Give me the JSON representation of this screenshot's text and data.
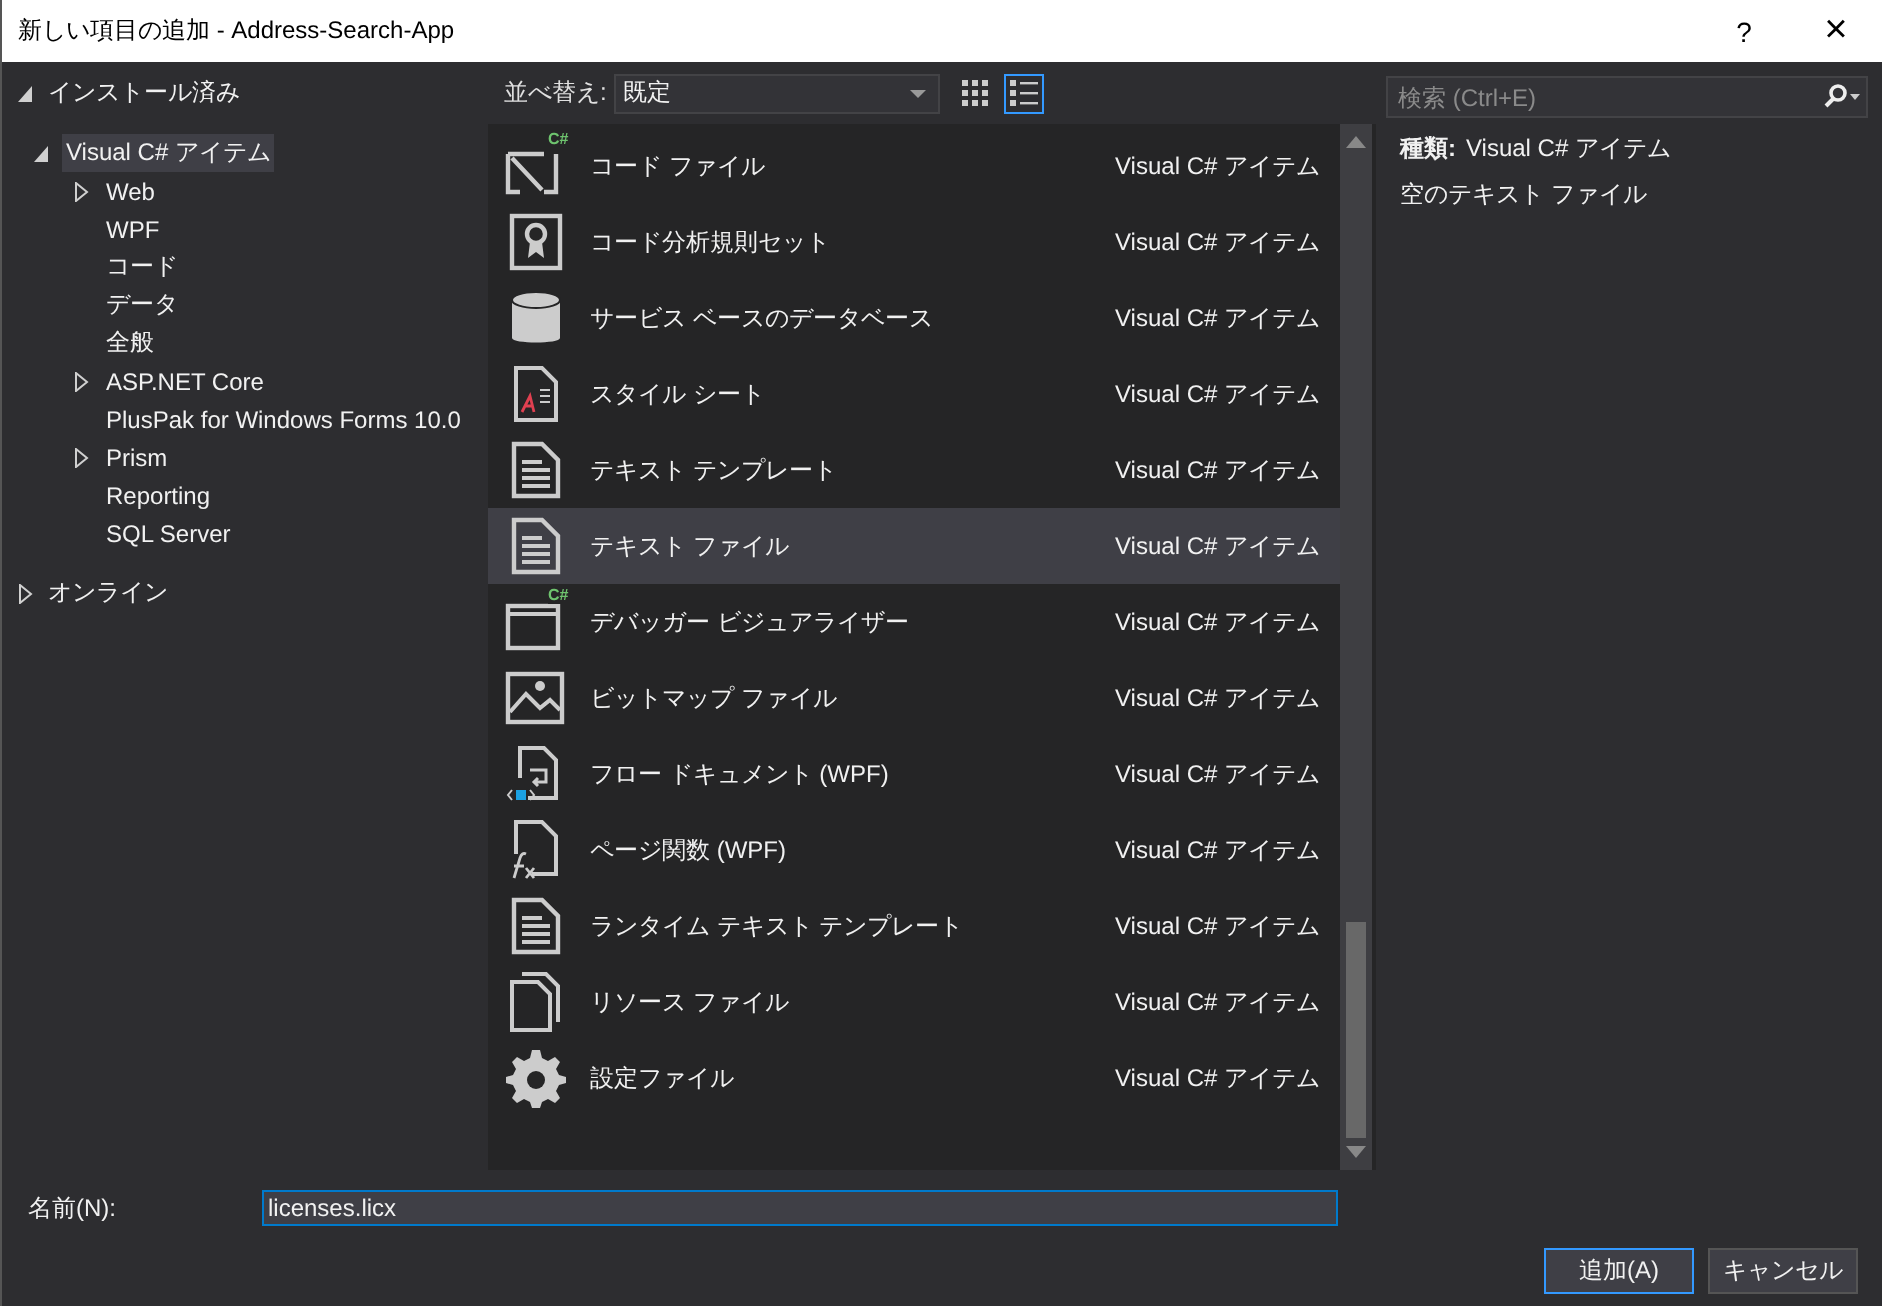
{
  "window": {
    "title": "新しい項目の追加 - Address-Search-App",
    "help": "?",
    "close": "×"
  },
  "tree": [
    {
      "label": "インストール済み",
      "expanded": true,
      "selected": false,
      "children": [
        {
          "label": "Visual C# アイテム",
          "expanded": true,
          "selected": true,
          "children": [
            {
              "label": "Web",
              "kind": "folder",
              "selected": false
            },
            {
              "label": "WPF",
              "kind": "leaf",
              "selected": false
            },
            {
              "label": "コード",
              "kind": "leaf",
              "selected": false
            },
            {
              "label": "データ",
              "kind": "leaf",
              "selected": false
            },
            {
              "label": "全般",
              "kind": "leaf",
              "selected": false
            },
            {
              "label": "ASP.NET Core",
              "kind": "folder",
              "selected": false
            },
            {
              "label": "PlusPak for Windows Forms 10.0",
              "kind": "leaf",
              "selected": false
            },
            {
              "label": "Prism",
              "kind": "folder",
              "selected": false
            },
            {
              "label": "Reporting",
              "kind": "leaf",
              "selected": false
            },
            {
              "label": "SQL Server",
              "kind": "leaf",
              "selected": false
            }
          ]
        }
      ]
    },
    {
      "label": "オンライン",
      "expanded": false,
      "selected": false
    }
  ],
  "sort": {
    "label": "並べ替え:",
    "value": "既定"
  },
  "view_modes": [
    {
      "kind": "grid",
      "selected": false
    },
    {
      "kind": "list",
      "selected": true
    }
  ],
  "search": {
    "placeholder": "検索 (Ctrl+E)"
  },
  "items": [
    {
      "kind": "code",
      "badge": "C#",
      "name": "コード ファイル",
      "category": "Visual C# アイテム",
      "selected": false
    },
    {
      "kind": "ribbon",
      "name": "コード分析規則セット",
      "category": "Visual C# アイテム",
      "selected": false
    },
    {
      "kind": "database",
      "name": "サービス ベースのデータベース",
      "category": "Visual C# アイテム",
      "selected": false
    },
    {
      "kind": "style",
      "name": "スタイル シート",
      "category": "Visual C# アイテム",
      "selected": false
    },
    {
      "kind": "text",
      "name": "テキスト テンプレート",
      "category": "Visual C# アイテム",
      "selected": false
    },
    {
      "kind": "text",
      "name": "テキスト ファイル",
      "category": "Visual C# アイテム",
      "selected": true
    },
    {
      "kind": "window",
      "badge": "C#",
      "name": "デバッガー ビジュアライザー",
      "category": "Visual C# アイテム",
      "selected": false
    },
    {
      "kind": "bitmap",
      "name": "ビットマップ ファイル",
      "category": "Visual C# アイテム",
      "selected": false
    },
    {
      "kind": "flow",
      "name": "フロー ドキュメント (WPF)",
      "category": "Visual C# アイテム",
      "selected": false
    },
    {
      "kind": "function",
      "name": "ページ関数 (WPF)",
      "category": "Visual C# アイテム",
      "selected": false
    },
    {
      "kind": "text",
      "name": "ランタイム テキスト テンプレート",
      "category": "Visual C# アイテム",
      "selected": false
    },
    {
      "kind": "resource",
      "name": "リソース ファイル",
      "category": "Visual C# アイテム",
      "selected": false
    },
    {
      "kind": "gear",
      "name": "設定ファイル",
      "category": "Visual C# アイテム",
      "selected": false
    }
  ],
  "details": {
    "type_label": "種類:",
    "type_value": "Visual C# アイテム",
    "description": "空のテキスト ファイル"
  },
  "name_field": {
    "label": "名前(N):",
    "value": "licenses.licx"
  },
  "buttons": [
    {
      "label": "追加(A)",
      "default": true
    },
    {
      "label": "キャンセル",
      "default": false
    }
  ]
}
